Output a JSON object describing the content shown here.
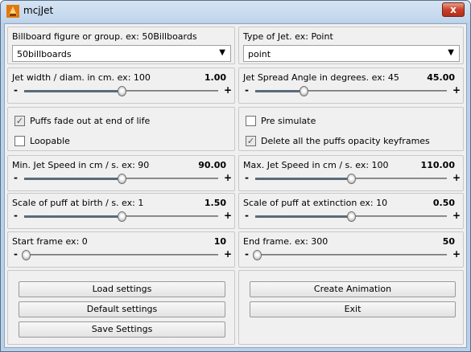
{
  "window": {
    "title": "mcjJet",
    "close_label": "x"
  },
  "billboard": {
    "label": "Billboard figure or group. ex: 50Billboards",
    "value": "50billboards",
    "arrow": "▼"
  },
  "jet_type": {
    "label": "Type of Jet. ex: Point",
    "value": "point",
    "arrow": "▼"
  },
  "sliders": [
    {
      "label": "Jet width / diam. in cm. ex: 100",
      "value": "1.00",
      "position": 0.5
    },
    {
      "label": "Jet Spread Angle in degrees. ex: 45",
      "value": "45.00",
      "position": 0.25
    },
    {
      "label": "Min. Jet Speed in cm / s. ex: 90",
      "value": "90.00",
      "position": 0.5
    },
    {
      "label": "Max. Jet Speed in cm / s. ex: 100",
      "value": "110.00",
      "position": 0.5
    },
    {
      "label": "Scale of puff at birth / s. ex: 1",
      "value": "1.50",
      "position": 0.5
    },
    {
      "label": "Scale of puff at extinction ex: 10",
      "value": "0.50",
      "position": 0.5
    },
    {
      "label": "Start frame ex: 0",
      "value": "10",
      "position": 0.01
    },
    {
      "label": "End frame. ex: 300",
      "value": "50",
      "position": 0.01
    }
  ],
  "slider_minus": "-",
  "slider_plus": "+",
  "checkboxes": {
    "puffs_fade": {
      "label": "Puffs fade out at end of life",
      "checked": true
    },
    "loopable": {
      "label": "Loopable",
      "checked": false
    },
    "pre_simulate": {
      "label": "Pre simulate",
      "checked": false
    },
    "delete_keyframes": {
      "label": "Delete all the puffs opacity keyframes",
      "checked": true
    }
  },
  "check_mark": "✓",
  "buttons": {
    "load_settings": "Load settings",
    "default_settings": "Default settings",
    "save_settings": "Save Settings",
    "create_animation": "Create Animation",
    "exit": "Exit"
  },
  "colors": {
    "window_frame": "#b9d1ea",
    "client_bg": "#f0f0f0",
    "close_button": "#c7402a"
  }
}
